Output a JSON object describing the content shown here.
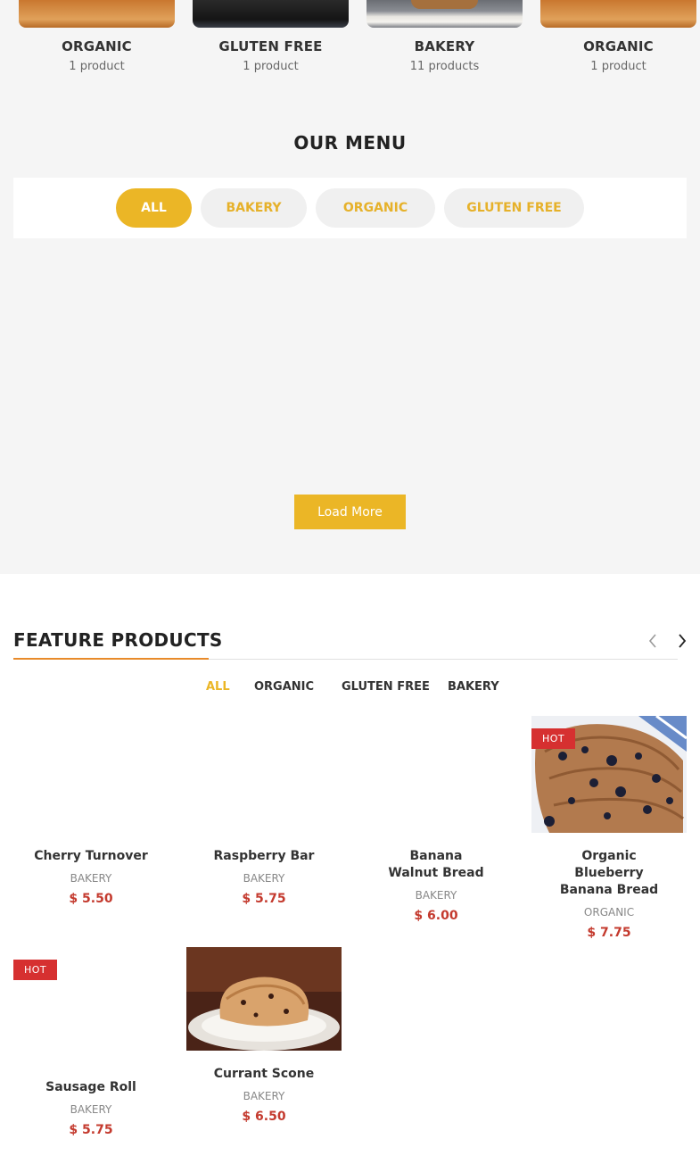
{
  "categories": [
    {
      "name": "ORGANIC",
      "count": "1 product"
    },
    {
      "name": "GLUTEN FREE",
      "count": "1 product"
    },
    {
      "name": "BAKERY",
      "count": "11 products"
    },
    {
      "name": "ORGANIC",
      "count": "1 product"
    }
  ],
  "menu": {
    "title": "OUR MENU",
    "tabs": [
      "ALL",
      "BAKERY",
      "ORGANIC",
      "GLUTEN FREE"
    ],
    "load_more": "Load More"
  },
  "featured": {
    "title": "FEATURE PRODUCTS",
    "tabs": [
      "ALL",
      "ORGANIC",
      "GLUTEN FREE",
      "BAKERY"
    ],
    "products": [
      {
        "name": "Cherry Turnover",
        "category": "BAKERY",
        "price": "$ 5.50"
      },
      {
        "name": "Raspberry Bar",
        "category": "BAKERY",
        "price": "$ 5.75"
      },
      {
        "name": "Banana Walnut Bread",
        "category": "BAKERY",
        "price": "$ 6.00"
      },
      {
        "name": "Organic Blueberry Banana Bread",
        "category": "ORGANIC",
        "price": "$ 7.75",
        "badge": "HOT"
      },
      {
        "name": "Sausage Roll",
        "category": "BAKERY",
        "price": "$ 5.75",
        "badge": "HOT"
      },
      {
        "name": "Currant Scone",
        "category": "BAKERY",
        "price": "$ 6.50"
      }
    ]
  },
  "colors": {
    "accent": "#ebb626",
    "underline": "#e88a2a",
    "price": "#c43a2e",
    "hot": "#d63030"
  },
  "icons": {
    "prev": "chevron-left-icon",
    "next": "chevron-right-icon"
  }
}
